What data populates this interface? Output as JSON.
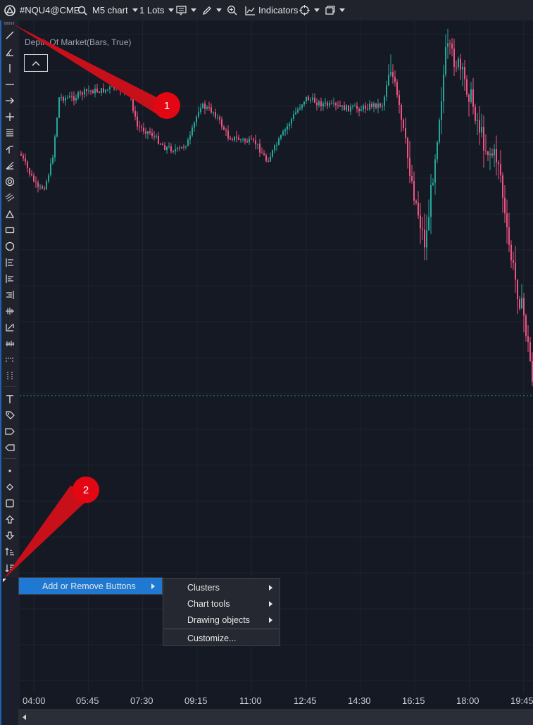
{
  "topbar": {
    "symbol": "#NQU4@CME",
    "timeframe": "M5 chart",
    "lots": "1 Lots",
    "indicators": "Indicators"
  },
  "chart": {
    "indicator_title": "Depth Of Market(Bars, True)",
    "x_labels": [
      "04:00",
      "05:45",
      "07:30",
      "09:15",
      "11:00",
      "12:45",
      "14:30",
      "16:15",
      "18:00",
      "19:45"
    ]
  },
  "context_menu": {
    "item": "Add or Remove Buttons"
  },
  "submenu": {
    "items": [
      "Clusters",
      "Chart tools",
      "Drawing objects"
    ],
    "customize": "Customize..."
  },
  "annotations": [
    "1",
    "2"
  ],
  "colors": {
    "up": "#26a69a",
    "down": "#ef5381",
    "annotation": "#e30613",
    "menu_highlight": "#1f78d1"
  },
  "icons": [
    "app-logo-icon",
    "search-icon",
    "chat-icon",
    "pencil-icon",
    "zoom-icon",
    "indicators-icon",
    "crosshair-icon",
    "window-icon"
  ]
}
